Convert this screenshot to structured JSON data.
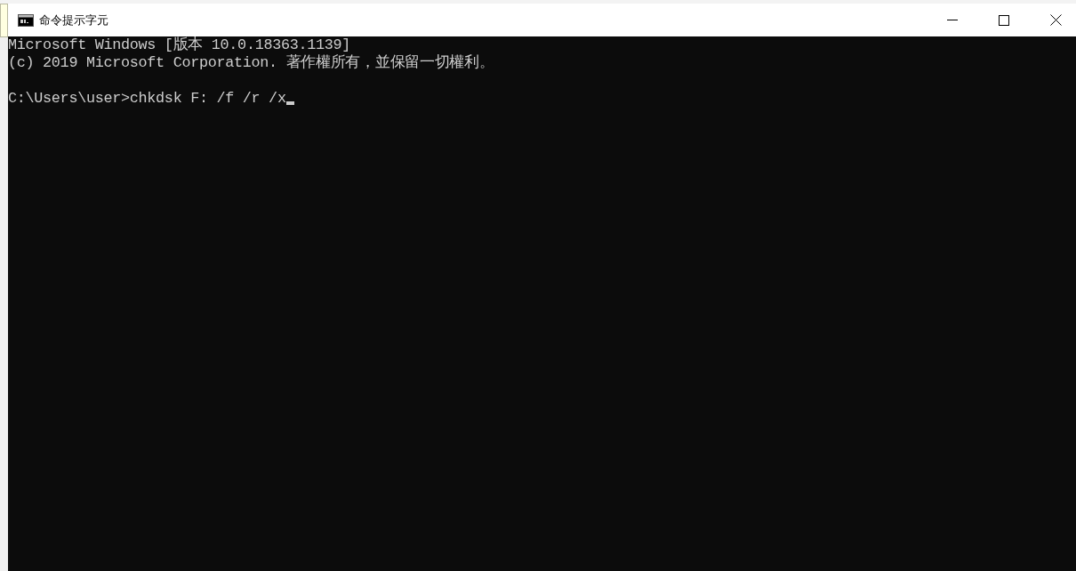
{
  "window": {
    "title": "命令提示字元"
  },
  "console": {
    "header_lines": [
      "Microsoft Windows [版本 10.0.18363.1139]",
      "(c) 2019 Microsoft Corporation. 著作權所有，並保留一切權利。"
    ],
    "prompt": "C:\\Users\\user>chkdsk F: /f /r /x"
  }
}
